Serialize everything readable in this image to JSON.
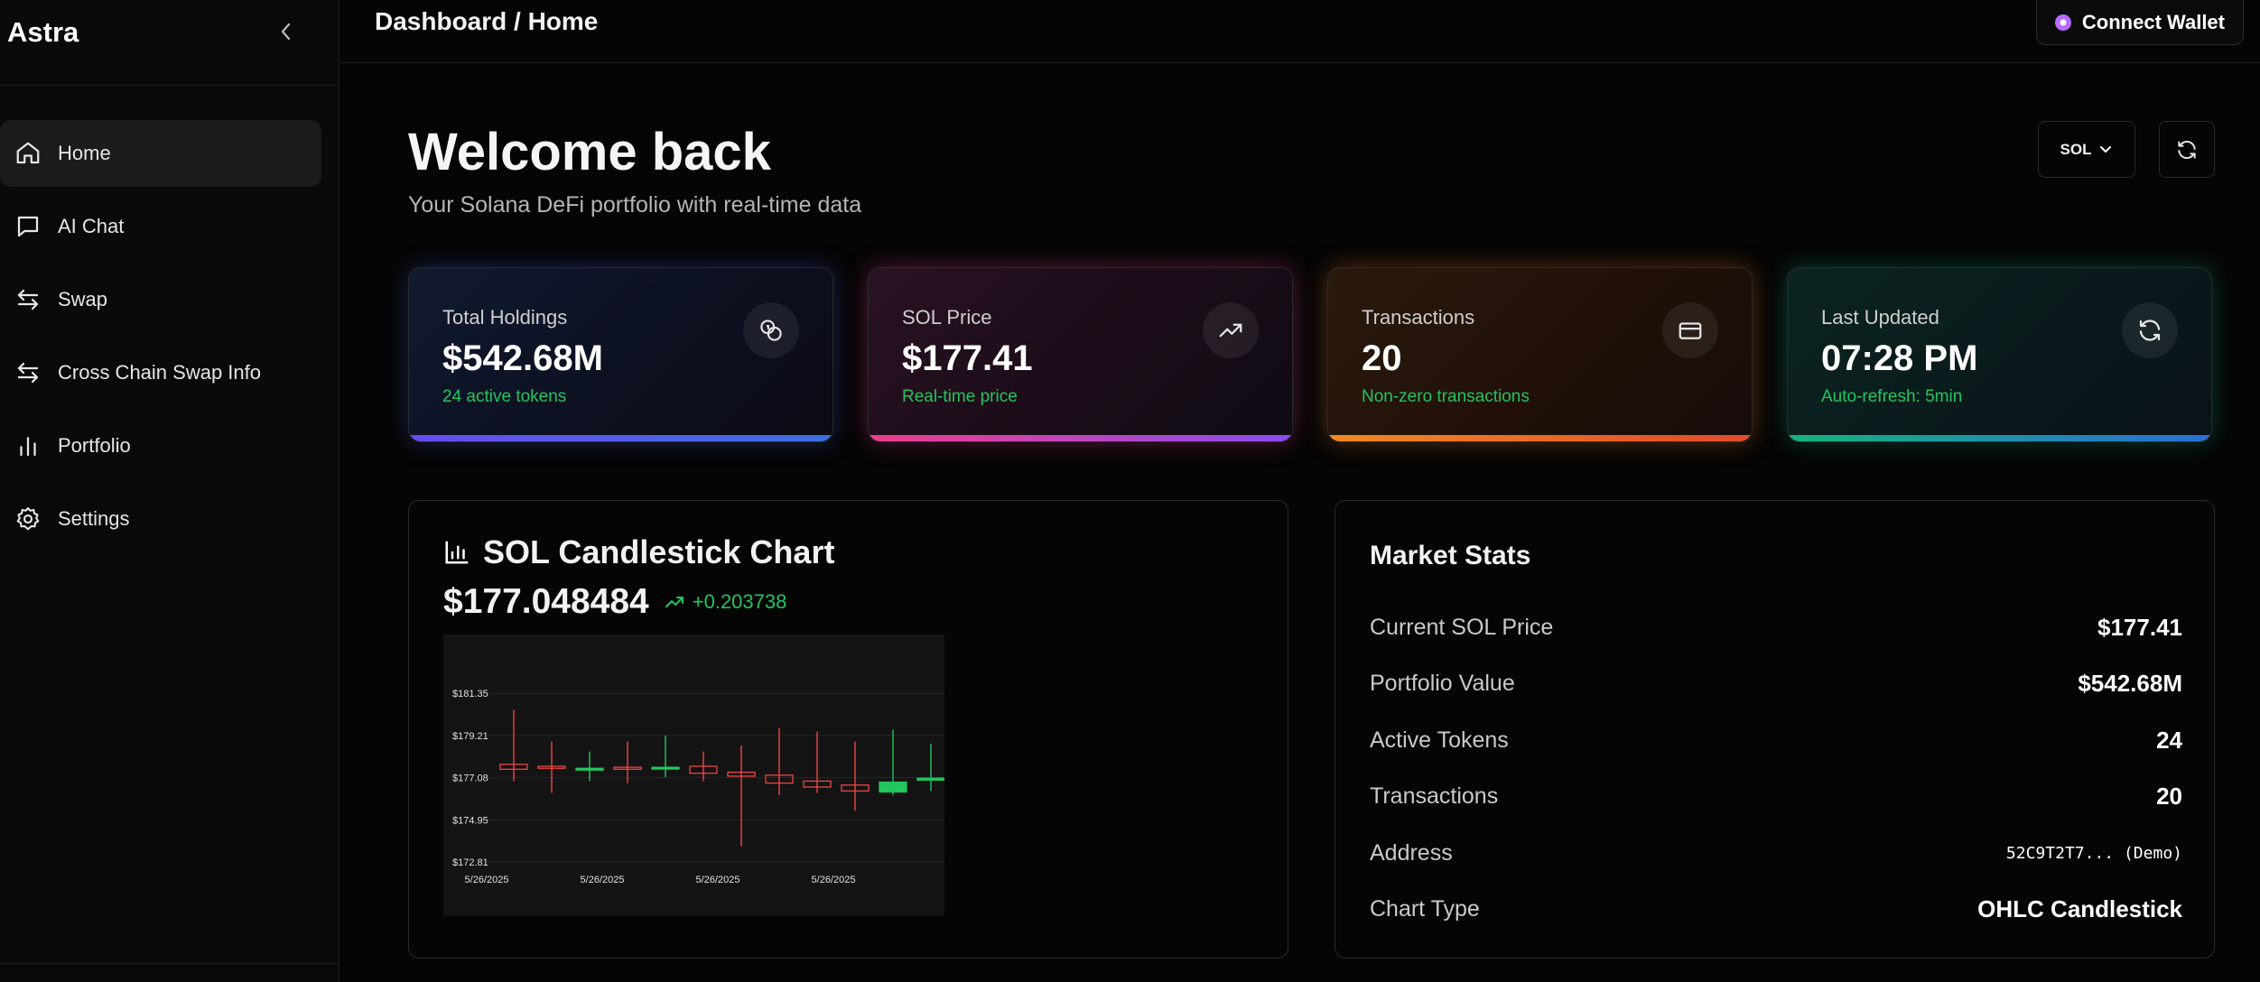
{
  "sidebar": {
    "brand": "Astra",
    "items": [
      {
        "label": "Home",
        "icon": "home-icon",
        "active": true
      },
      {
        "label": "AI Chat",
        "icon": "chat-icon"
      },
      {
        "label": "Swap",
        "icon": "swap-icon"
      },
      {
        "label": "Cross Chain Swap Info",
        "icon": "swap-icon"
      },
      {
        "label": "Portfolio",
        "icon": "bar-chart-icon"
      },
      {
        "label": "Settings",
        "icon": "gear-icon"
      }
    ]
  },
  "topbar": {
    "breadcrumb": "Dashboard / Home",
    "connect_label": "Connect Wallet"
  },
  "header": {
    "title": "Welcome back",
    "subtitle": "Your Solana DeFi portfolio with real-time data",
    "token_select": "SOL"
  },
  "cards": [
    {
      "label": "Total Holdings",
      "value": "$542.68M",
      "note": "24 active tokens",
      "icon": "coins-icon"
    },
    {
      "label": "SOL Price",
      "value": "$177.41",
      "note": "Real-time price",
      "icon": "trending-up-icon"
    },
    {
      "label": "Transactions",
      "value": "20",
      "note": "Non-zero transactions",
      "icon": "credit-card-icon"
    },
    {
      "label": "Last Updated",
      "value": "07:28 PM",
      "note": "Auto-refresh: 5min",
      "icon": "refresh-icon"
    }
  ],
  "chart_panel": {
    "title": "SOL Candlestick Chart",
    "price": "$177.048484",
    "change": "+0.203738"
  },
  "chart_data": {
    "type": "candlestick",
    "title": "",
    "y_ticks": [
      "$181.35",
      "$179.21",
      "$177.08",
      "$174.95",
      "$172.81"
    ],
    "ylim": [
      172.81,
      181.35
    ],
    "x_ticks": [
      "5/26/2025",
      "5/26/2025",
      "5/26/2025",
      "5/26/2025"
    ],
    "candles": [
      {
        "open": 177.5,
        "high": 180.5,
        "low": 176.9,
        "close": 177.75,
        "color": "#ef4444"
      },
      {
        "open": 177.65,
        "high": 178.9,
        "low": 176.3,
        "close": 177.55,
        "color": "#ef4444"
      },
      {
        "open": 177.55,
        "high": 178.4,
        "low": 176.9,
        "close": 177.55,
        "color": "#22c55e"
      },
      {
        "open": 177.6,
        "high": 178.9,
        "low": 176.8,
        "close": 177.5,
        "color": "#ef4444"
      },
      {
        "open": 177.55,
        "high": 179.2,
        "low": 177.1,
        "close": 177.6,
        "color": "#22c55e"
      },
      {
        "open": 177.65,
        "high": 178.4,
        "low": 176.9,
        "close": 177.3,
        "color": "#ef4444"
      },
      {
        "open": 177.35,
        "high": 178.7,
        "low": 173.6,
        "close": 177.15,
        "color": "#ef4444"
      },
      {
        "open": 177.2,
        "high": 179.6,
        "low": 176.2,
        "close": 176.8,
        "color": "#ef4444"
      },
      {
        "open": 176.9,
        "high": 179.4,
        "low": 176.3,
        "close": 176.6,
        "color": "#ef4444"
      },
      {
        "open": 176.7,
        "high": 178.9,
        "low": 175.4,
        "close": 176.4,
        "color": "#ef4444"
      },
      {
        "open": 176.35,
        "high": 179.5,
        "low": 176.2,
        "close": 176.85,
        "color": "#22c55e"
      },
      {
        "open": 176.95,
        "high": 178.8,
        "low": 176.4,
        "close": 177.05,
        "color": "#22c55e"
      }
    ]
  },
  "market_stats": {
    "title": "Market Stats",
    "rows": [
      {
        "label": "Current SOL Price",
        "value": "$177.41"
      },
      {
        "label": "Portfolio Value",
        "value": "$542.68M"
      },
      {
        "label": "Active Tokens",
        "value": "24"
      },
      {
        "label": "Transactions",
        "value": "20"
      },
      {
        "label": "Address",
        "value": "52C9T2T7... (Demo)"
      },
      {
        "label": "Chart Type",
        "value": "OHLC Candlestick"
      }
    ]
  }
}
